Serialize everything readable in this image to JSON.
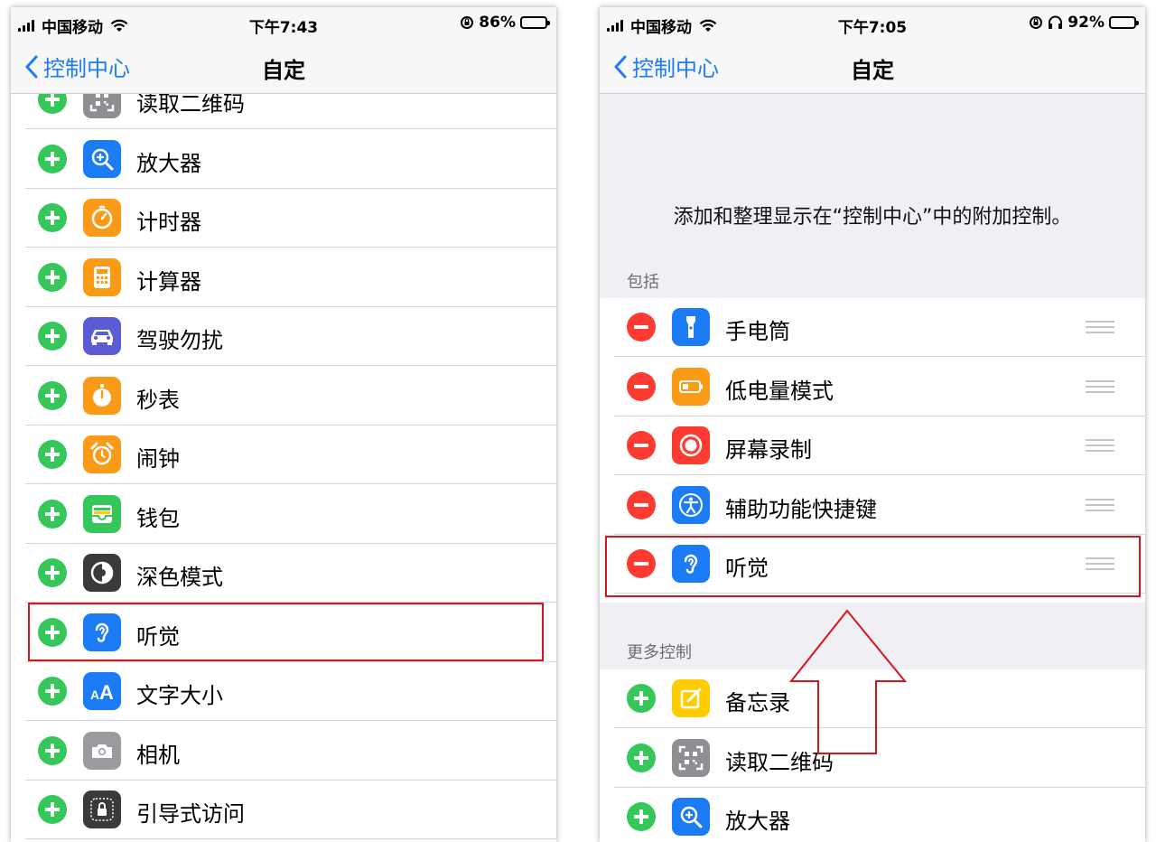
{
  "left_phone": {
    "status": {
      "carrier": "中国移动",
      "time": "下午7:43",
      "battery": "86%",
      "battery_fraction": 0.86
    },
    "nav": {
      "back_label": "控制中心",
      "title": "自定"
    },
    "items": [
      {
        "label": "读取二维码",
        "icon": "qr-code-icon",
        "color": "#8e8e93"
      },
      {
        "label": "放大器",
        "icon": "magnifier-icon",
        "color": "#1b7cf5"
      },
      {
        "label": "计时器",
        "icon": "timer-icon",
        "color": "#fb9a16"
      },
      {
        "label": "计算器",
        "icon": "calculator-icon",
        "color": "#fb9a16"
      },
      {
        "label": "驾驶勿扰",
        "icon": "car-icon",
        "color": "#5b5bd6"
      },
      {
        "label": "秒表",
        "icon": "stopwatch-icon",
        "color": "#fb9a16"
      },
      {
        "label": "闹钟",
        "icon": "alarm-icon",
        "color": "#fb9a16"
      },
      {
        "label": "钱包",
        "icon": "wallet-icon",
        "color": "#35c759"
      },
      {
        "label": "深色模式",
        "icon": "dark-mode-icon",
        "color": "#3a3a3c"
      },
      {
        "label": "听觉",
        "icon": "ear-icon",
        "color": "#1b7cf5"
      },
      {
        "label": "文字大小",
        "icon": "text-size-icon",
        "color": "#1b7cf5",
        "glyph": "AA"
      },
      {
        "label": "相机",
        "icon": "camera-icon",
        "color": "#9a9a9f"
      },
      {
        "label": "引导式访问",
        "icon": "guided-access-icon",
        "color": "#3a3a3c"
      }
    ]
  },
  "right_phone": {
    "status": {
      "carrier": "中国移动",
      "time": "下午7:05",
      "battery": "92%",
      "battery_fraction": 0.92
    },
    "nav": {
      "back_label": "控制中心",
      "title": "自定"
    },
    "intro": "添加和整理显示在“控制中心”中的附加控制。",
    "included_header": "包括",
    "included": [
      {
        "label": "手电筒",
        "icon": "flashlight-icon",
        "color": "#1b7cf5"
      },
      {
        "label": "低电量模式",
        "icon": "low-power-icon",
        "color": "#fb9a16"
      },
      {
        "label": "屏幕录制",
        "icon": "screen-record-icon",
        "color": "#fe3b30"
      },
      {
        "label": "辅助功能快捷键",
        "icon": "accessibility-icon",
        "color": "#1b7cf5"
      },
      {
        "label": "听觉",
        "icon": "ear-icon",
        "color": "#1b7cf5"
      }
    ],
    "more_header": "更多控制",
    "more": [
      {
        "label": "备忘录",
        "icon": "notes-icon",
        "color": "#ffcc00"
      },
      {
        "label": "读取二维码",
        "icon": "qr-code-icon",
        "color": "#8e8e93"
      },
      {
        "label": "放大器",
        "icon": "magnifier-icon",
        "color": "#1b7cf5"
      }
    ]
  },
  "annotation_color": "#d8141f"
}
